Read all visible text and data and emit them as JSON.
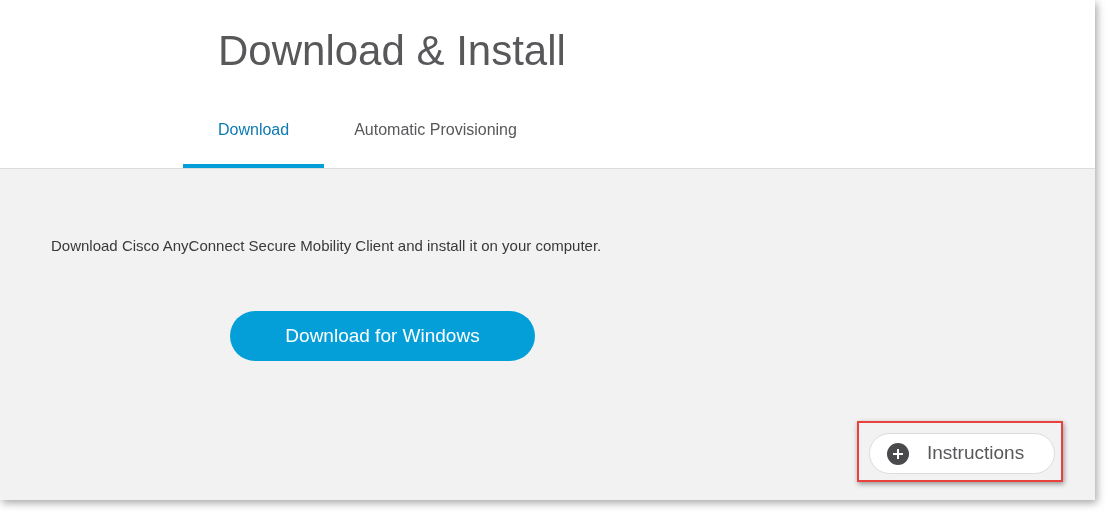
{
  "page": {
    "title": "Download & Install"
  },
  "tabs": [
    {
      "label": "Download",
      "selected": true
    },
    {
      "label": "Automatic Provisioning",
      "selected": false
    }
  ],
  "description": "Download Cisco AnyConnect Secure Mobility Client and install it on your computer.",
  "download_button": "Download for Windows",
  "instructions_button": {
    "label": "Instructions",
    "highlighted": true
  }
}
